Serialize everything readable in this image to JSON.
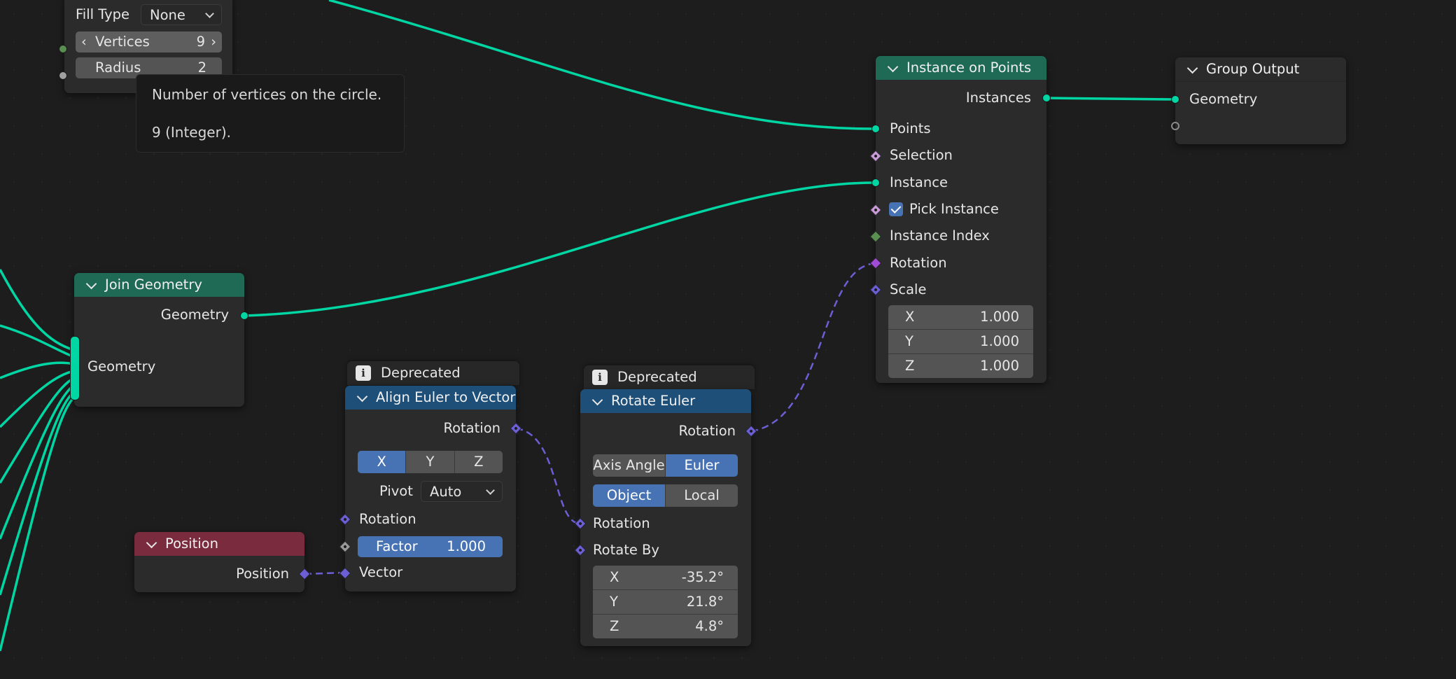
{
  "circle_node": {
    "fill_type_label": "Fill Type",
    "fill_type_value": "None",
    "vertices_label": "Vertices",
    "vertices_value": "9",
    "radius_label": "Radius",
    "radius_value": "2"
  },
  "tooltip": {
    "line1": "Number of vertices on the circle.",
    "line2": "9 (Integer)."
  },
  "instance_on_points": {
    "title": "Instance on Points",
    "out_instances": "Instances",
    "in_points": "Points",
    "in_selection": "Selection",
    "in_instance": "Instance",
    "in_pick_instance": "Pick Instance",
    "in_instance_index": "Instance Index",
    "in_rotation": "Rotation",
    "in_scale": "Scale",
    "scale": [
      {
        "axis": "X",
        "value": "1.000"
      },
      {
        "axis": "Y",
        "value": "1.000"
      },
      {
        "axis": "Z",
        "value": "1.000"
      }
    ]
  },
  "group_output": {
    "title": "Group Output",
    "in_geometry": "Geometry"
  },
  "join_geometry": {
    "title": "Join Geometry",
    "out_geometry": "Geometry",
    "in_geometry": "Geometry"
  },
  "align_euler": {
    "deprecated": "Deprecated",
    "title": "Align Euler to Vector",
    "out_rotation": "Rotation",
    "axes": [
      "X",
      "Y",
      "Z"
    ],
    "pivot_label": "Pivot",
    "pivot_value": "Auto",
    "in_rotation": "Rotation",
    "factor_label": "Factor",
    "factor_value": "1.000",
    "in_vector": "Vector"
  },
  "position_node": {
    "title": "Position",
    "out_position": "Position"
  },
  "rotate_euler": {
    "deprecated": "Deprecated",
    "title": "Rotate Euler",
    "out_rotation": "Rotation",
    "type_options": [
      "Axis Angle",
      "Euler"
    ],
    "space_options": [
      "Object",
      "Local"
    ],
    "in_rotation": "Rotation",
    "in_rotate_by": "Rotate By",
    "rotate_by": [
      {
        "axis": "X",
        "value": "-35.2°"
      },
      {
        "axis": "Y",
        "value": "21.8°"
      },
      {
        "axis": "Z",
        "value": "4.8°"
      }
    ]
  },
  "colors": {
    "geometry_wire": "#00d6a3",
    "vector_wire": "#6c5fd6",
    "geometry_header": "#1f6a54",
    "utility_header": "#1d4f78",
    "input_header": "#7a2b3d",
    "active_button": "#4772b3"
  },
  "icons": {
    "deprecated": "info-icon",
    "collapse": "chevron-down-icon",
    "checkbox": "checkmark-icon"
  }
}
